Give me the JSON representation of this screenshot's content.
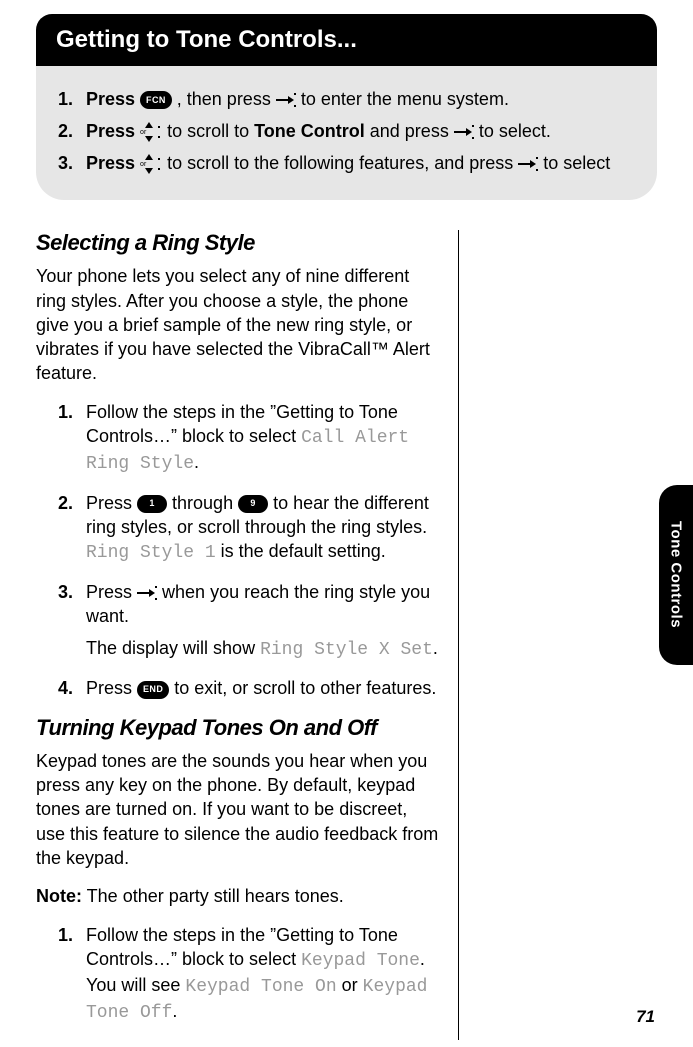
{
  "title": "Getting to Tone Controls...",
  "side_tab": "Tone Controls",
  "page_number": "71",
  "intro": {
    "steps": [
      {
        "num": "1.",
        "pre": "Press ",
        "key": "FCN",
        "mid": ", then press ",
        "post": " to enter the menu system."
      },
      {
        "num": "2.",
        "pre": "Press  ",
        "mid1": " to scroll to ",
        "bold": "Tone Control",
        "mid2": " and press ",
        "post": " to select."
      },
      {
        "num": "3.",
        "pre": "Press  ",
        "mid": " to scroll to the following features, and press ",
        "post": " to select"
      }
    ]
  },
  "section_a": {
    "heading": "Selecting a Ring Style",
    "intro": "Your phone lets you select any of nine different ring styles. After you choose a style, the phone give you a brief sample of the new ring style, or vibrates if you have selected the VibraCall™ Alert feature.",
    "steps": {
      "s1": {
        "num": "1.",
        "text_a": "Follow the steps in the ”Getting to Tone Controls…” block to select ",
        "lcd_a": "Call Alert Ring Style",
        "text_b": "."
      },
      "s2": {
        "num": "2.",
        "text_a": "Press ",
        "key_a": "1",
        "text_b": " through ",
        "key_b": "9",
        "text_c": " to hear the different ring styles, or scroll through the ring styles. ",
        "lcd_a": "Ring Style 1",
        "text_d": " is the default setting."
      },
      "s3": {
        "num": "3.",
        "text_a": "Press ",
        "text_b": " when you reach the ring style you want.",
        "sub_a": "The display will show ",
        "lcd_a": "Ring Style X Set",
        "sub_b": "."
      },
      "s4": {
        "num": "4.",
        "text_a": "Press ",
        "key_a": "END",
        "text_b": " to exit, or scroll to other features."
      }
    }
  },
  "section_b": {
    "heading": "Turning Keypad Tones On and Off",
    "intro": "Keypad tones are the sounds you hear when you press any key on the phone. By default, keypad tones are turned on. If you want to be discreet, use this feature to silence the audio feedback from the keypad.",
    "note_label": "Note:",
    "note_text": " The other party still hears tones.",
    "steps": {
      "s1": {
        "num": "1.",
        "text_a": "Follow the steps in the ”Getting to Tone Controls…” block to select ",
        "lcd_a": "Keypad Tone",
        "text_b": ". You will see ",
        "lcd_b": "Keypad Tone On",
        "text_c": " or ",
        "lcd_c": "Keypad Tone Off",
        "text_d": "."
      }
    }
  }
}
